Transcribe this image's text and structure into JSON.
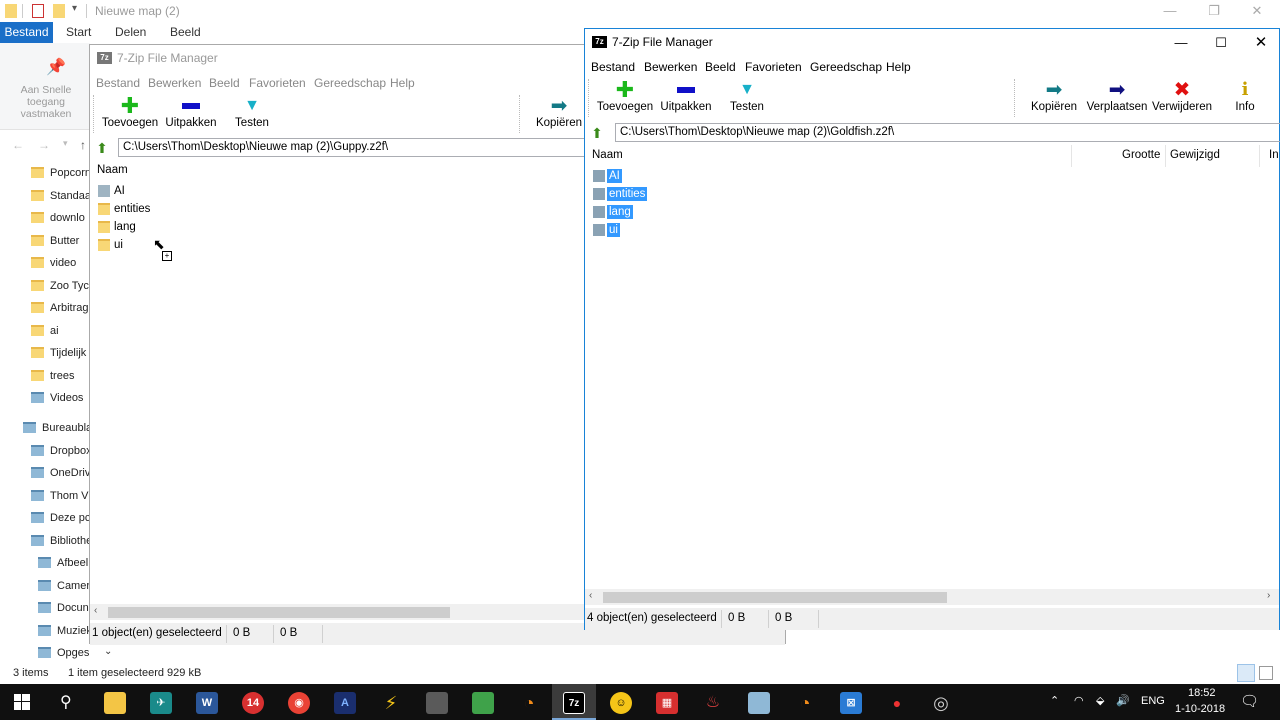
{
  "explorer": {
    "title": "Nieuwe map (2)",
    "tabs": {
      "file": "Bestand",
      "start": "Start",
      "share": "Delen",
      "view": "Beeld"
    },
    "pin_label": "Aan Snelle toegang vastmaken",
    "nav_items": [
      {
        "label": "Popcorn",
        "level": 2,
        "icon": "folder-icon"
      },
      {
        "label": "Standaa",
        "level": 2,
        "icon": "folder-icon"
      },
      {
        "label": "downlo",
        "level": 2,
        "icon": "folder-icon"
      },
      {
        "label": "Butter",
        "level": 2,
        "icon": "folder-icon"
      },
      {
        "label": "video",
        "level": 2,
        "icon": "folder-icon"
      },
      {
        "label": "Zoo Tyc",
        "level": 2,
        "icon": "folder-icon"
      },
      {
        "label": "Arbitrag",
        "level": 2,
        "icon": "folder-icon"
      },
      {
        "label": "ai",
        "level": 2,
        "icon": "folder-icon"
      },
      {
        "label": "Tijdelijk",
        "level": 2,
        "icon": "folder-icon"
      },
      {
        "label": "trees",
        "level": 2,
        "icon": "folder-icon"
      },
      {
        "label": "Videos",
        "level": 2,
        "icon": "video-folder-icon"
      },
      {
        "label": "Bureaubla",
        "level": 1,
        "icon": "desktop-icon"
      },
      {
        "label": "Dropbox",
        "level": 2,
        "icon": "dropbox-icon"
      },
      {
        "label": "OneDriv",
        "level": 2,
        "icon": "onedrive-icon"
      },
      {
        "label": "Thom V",
        "level": 2,
        "icon": "user-icon"
      },
      {
        "label": "Deze pc",
        "level": 2,
        "icon": "pc-icon"
      },
      {
        "label": "Bibliothe",
        "level": 2,
        "icon": "library-icon"
      },
      {
        "label": "Afbeel",
        "level": 3,
        "icon": "pictures-icon"
      },
      {
        "label": "Camer",
        "level": 3,
        "icon": "camera-icon"
      },
      {
        "label": "Docun",
        "level": 3,
        "icon": "documents-icon"
      },
      {
        "label": "Muziek",
        "level": 3,
        "icon": "music-icon"
      },
      {
        "label": "Opgeslag",
        "level": 3,
        "icon": "saved-icon"
      }
    ],
    "status_items": "3 items",
    "status_selected": "1 item geselecteerd  929 kB"
  },
  "zip_left": {
    "title": "7-Zip File Manager",
    "menu": [
      "Bestand",
      "Bewerken",
      "Beeld",
      "Favorieten",
      "Gereedschap",
      "Help"
    ],
    "toolbar": {
      "add": "Toevoegen",
      "extract": "Uitpakken",
      "test": "Testen",
      "copy": "Kopiëren"
    },
    "address": "C:\\Users\\Thom\\Desktop\\Nieuwe map (2)\\Guppy.z2f\\",
    "col_name": "Naam",
    "files": [
      {
        "name": "AI",
        "type": "gray"
      },
      {
        "name": "entities",
        "type": "folder"
      },
      {
        "name": "lang",
        "type": "folder"
      },
      {
        "name": "ui",
        "type": "folder"
      }
    ],
    "status": {
      "selected": "1 object(en) geselecteerd",
      "size": "0 B",
      "packed": "0 B"
    }
  },
  "zip_right": {
    "title": "7-Zip File Manager",
    "menu": [
      "Bestand",
      "Bewerken",
      "Beeld",
      "Favorieten",
      "Gereedschap",
      "Help"
    ],
    "toolbar": {
      "add": "Toevoegen",
      "extract": "Uitpakken",
      "test": "Testen",
      "copy": "Kopiëren",
      "move": "Verplaatsen",
      "delete": "Verwijderen",
      "info": "Info"
    },
    "address": "C:\\Users\\Thom\\Desktop\\Nieuwe map (2)\\Goldfish.z2f\\",
    "columns": {
      "name": "Naam",
      "size": "Grootte",
      "modified": "Gewijzigd",
      "more": "In"
    },
    "files": [
      {
        "name": "AI",
        "type": "gray"
      },
      {
        "name": "entities",
        "type": "folder"
      },
      {
        "name": "lang",
        "type": "folder"
      },
      {
        "name": "ui",
        "type": "folder"
      }
    ],
    "status": {
      "selected": "4 object(en) geselecteerd",
      "size": "0 B",
      "packed": "0 B"
    }
  },
  "taskbar": {
    "language": "ENG",
    "time": "18:52",
    "date": "1-10-2018",
    "badge_14": "14"
  },
  "colors": {
    "selection": "#3399ff",
    "ribbon_file_tab": "#1a6fc8",
    "taskbar": "#101010"
  }
}
